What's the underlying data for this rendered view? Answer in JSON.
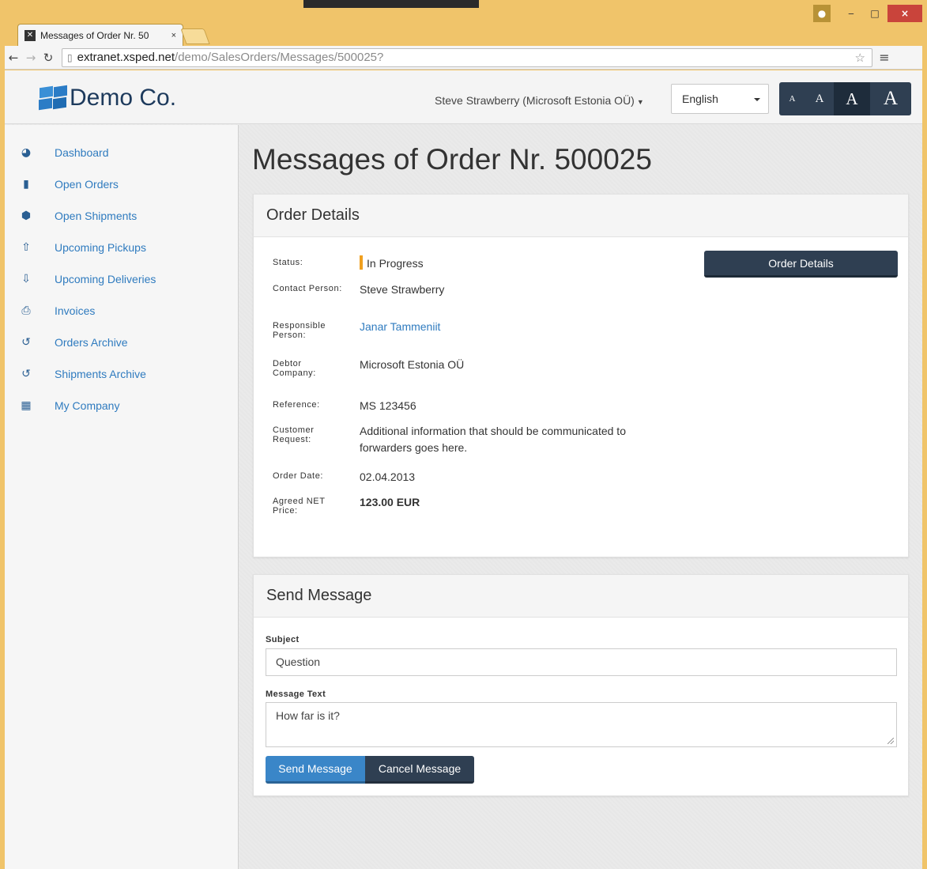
{
  "browser": {
    "tab_title": "Messages of Order Nr. 50",
    "tab_close": "×",
    "url_host": "extranet.xsped.net",
    "url_path": "/demo/SalesOrders/Messages/500025?"
  },
  "header": {
    "logo_text": "Demo Co.",
    "user": "Steve Strawberry (Microsoft Estonia OÜ)",
    "language": "English",
    "font_sizes": [
      "A",
      "A",
      "A",
      "A"
    ]
  },
  "sidebar": {
    "items": [
      {
        "label": "Dashboard",
        "icon": "dashboard-icon"
      },
      {
        "label": "Open Orders",
        "icon": "document-icon"
      },
      {
        "label": "Open Shipments",
        "icon": "cube-icon"
      },
      {
        "label": "Upcoming Pickups",
        "icon": "upload-icon"
      },
      {
        "label": "Upcoming Deliveries",
        "icon": "download-icon"
      },
      {
        "label": "Invoices",
        "icon": "pdf-icon"
      },
      {
        "label": "Orders Archive",
        "icon": "history-icon"
      },
      {
        "label": "Shipments Archive",
        "icon": "history-icon"
      },
      {
        "label": "My Company",
        "icon": "building-icon"
      }
    ]
  },
  "page": {
    "title": "Messages of Order Nr. 500025"
  },
  "order_details": {
    "heading": "Order Details",
    "button": "Order Details",
    "status_label": "Status:",
    "status_value": "In Progress",
    "status_color": "#f0a020",
    "contact_label": "Contact Person:",
    "contact_value": "Steve Strawberry",
    "responsible_label": "Responsible Person:",
    "responsible_value": "Janar Tammeniit",
    "debtor_label": "Debtor Company:",
    "debtor_value": "Microsoft Estonia OÜ",
    "reference_label": "Reference:",
    "reference_value": "MS 123456",
    "request_label": "Customer Request:",
    "request_value": "Additional information that should be communicated to forwarders goes here.",
    "date_label": "Order Date:",
    "date_value": "02.04.2013",
    "price_label": "Agreed NET Price:",
    "price_value": "123.00 EUR"
  },
  "send_message": {
    "heading": "Send Message",
    "subject_label": "Subject",
    "subject_value": "Question",
    "text_label": "Message Text",
    "text_value": "How far is it?",
    "send_label": "Send Message",
    "cancel_label": "Cancel Message"
  },
  "colors": {
    "accent": "#3a86c8",
    "dark": "#2f3f52",
    "link": "#2f7bbf"
  }
}
